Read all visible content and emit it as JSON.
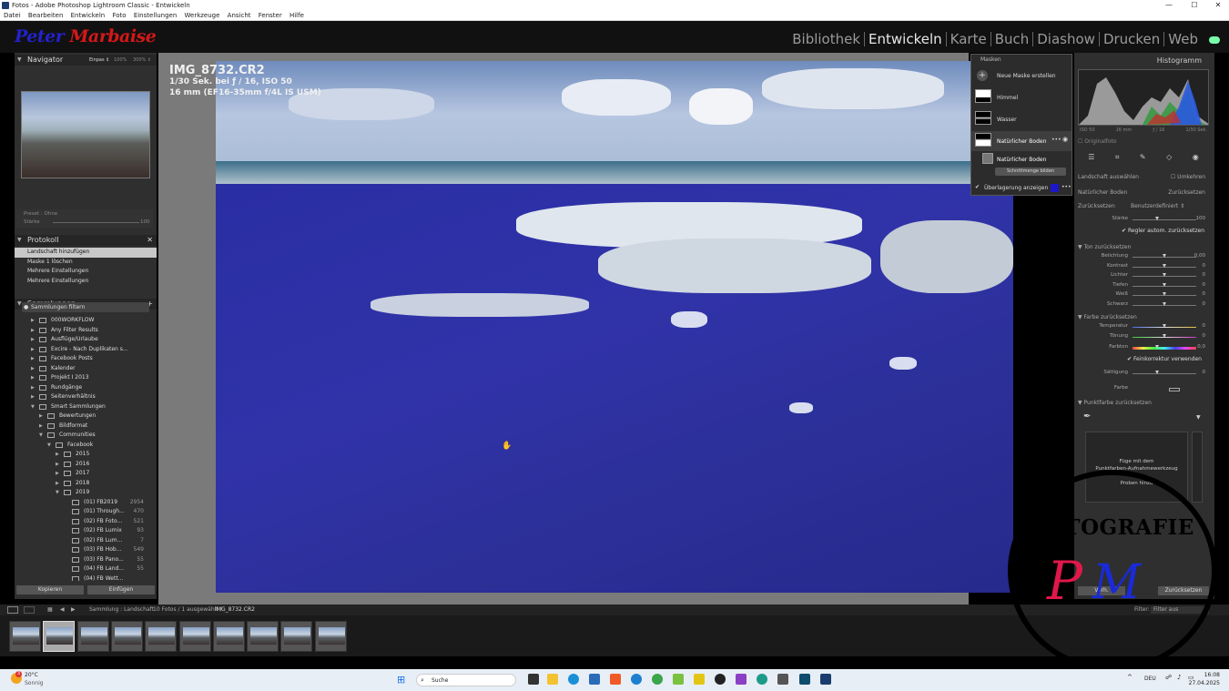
{
  "titlebar": {
    "title": "Fotos - Adobe Photoshop Lightroom Classic - Entwickeln",
    "minimize": "—",
    "maximize": "☐",
    "close": "✕"
  },
  "menu": [
    "Datei",
    "Bearbeiten",
    "Entwickeln",
    "Foto",
    "Einstellungen",
    "Werkzeuge",
    "Ansicht",
    "Fenster",
    "Hilfe"
  ],
  "identity": {
    "logo_first": "Peter",
    "logo_last": "Marbaise"
  },
  "modules": [
    "Bibliothek",
    "Entwickeln",
    "Karte",
    "Buch",
    "Diashow",
    "Drucken",
    "Web"
  ],
  "navigator": {
    "title": "Navigator",
    "zoom_options": [
      "Einpas ⇕",
      "100%",
      "300% ⇕"
    ]
  },
  "preset": {
    "label": "Preset : Ohne",
    "amount_label": "Stärke",
    "amount_value": "100"
  },
  "history": {
    "title": "Protokoll",
    "close": "✕",
    "items": [
      "Landschaft hinzufügen",
      "Maske 1 löschen",
      "Mehrere Einstellungen",
      "Mehrere Einstellungen"
    ]
  },
  "collections": {
    "title": "Sammlungen",
    "filter_placeholder": "Sammlungen filtern",
    "items": [
      {
        "label": "000WORKFLOW",
        "count": ""
      },
      {
        "label": "Any Filter Results",
        "count": ""
      },
      {
        "label": "Ausflüge/Urlaube",
        "count": ""
      },
      {
        "label": "Excire - Nach Duplikaten s...",
        "count": ""
      },
      {
        "label": "Facebook Posts",
        "count": ""
      },
      {
        "label": "Kalender",
        "count": ""
      },
      {
        "label": "Projekt I 2013",
        "count": ""
      },
      {
        "label": "Rundgänge",
        "count": ""
      },
      {
        "label": "Seitenverhältnis",
        "count": ""
      },
      {
        "label": "Smart Sammlungen",
        "count": ""
      },
      {
        "label": "Bewertungen",
        "count": ""
      },
      {
        "label": "Bildformat",
        "count": ""
      },
      {
        "label": "Communities",
        "count": ""
      },
      {
        "label": "Facebook",
        "count": ""
      },
      {
        "label": "2015",
        "count": ""
      },
      {
        "label": "2016",
        "count": ""
      },
      {
        "label": "2017",
        "count": ""
      },
      {
        "label": "2018",
        "count": ""
      },
      {
        "label": "2019",
        "count": ""
      },
      {
        "label": "(01) FB2019",
        "count": "2954"
      },
      {
        "label": "(01) Through...",
        "count": "470"
      },
      {
        "label": "(02) FB Foto...",
        "count": "521"
      },
      {
        "label": "(02) FB Lumix",
        "count": "93"
      },
      {
        "label": "(02) FB Lum...",
        "count": "7"
      },
      {
        "label": "(03) FB Hob...",
        "count": "549"
      },
      {
        "label": "(03) FB Pano...",
        "count": "55"
      },
      {
        "label": "(04) FB Land...",
        "count": "55"
      },
      {
        "label": "(04) FB Wett...",
        "count": ""
      }
    ],
    "copy_button": "Kopieren",
    "paste_button": "Einfügen"
  },
  "photo": {
    "filename": "IMG_8732.CR2",
    "exposure": "1/30 Sek. bei ƒ / 16, ISO 50",
    "lens": "16 mm (EF16-35mm f/4L IS USM)"
  },
  "masks": {
    "title": "Masken",
    "new_mask": "Neue Maske erstellen",
    "items": [
      "Himmel",
      "Wasser",
      "Natürlicher Boden"
    ],
    "sub_item": "Natürlicher Boden",
    "intersect": "Schnittmenge bilden",
    "overlay": "Überlagerung anzeigen",
    "overlay_color": "#1c16c8"
  },
  "histogram": {
    "title": "Histogramm",
    "iso": "ISO 50",
    "focal": "16 mm",
    "aperture": "ƒ / 16",
    "shutter": "1/30 Sek.",
    "original": "Originalfoto"
  },
  "adjust": {
    "landscape_select": "Landschaft auswählen",
    "invert": "Umkehren",
    "mask_name": "Natürlicher Boden",
    "reset": "Zurücksetzen",
    "effect_label": "Zurücksetzen",
    "effect_value": "Benutzerdefiniert ⇕",
    "amount_label": "Stärke",
    "amount_value": "100",
    "auto_reset": "Regler autom. zurücksetzen",
    "tone_head": "Ton zurücksetzen",
    "tone": [
      {
        "label": "Belichtung",
        "value": "0,00",
        "pos": 0.5
      },
      {
        "label": "Kontrast",
        "value": "0",
        "pos": 0.5
      },
      {
        "label": "Lichter",
        "value": "0",
        "pos": 0.5
      },
      {
        "label": "Tiefen",
        "value": "0",
        "pos": 0.5
      },
      {
        "label": "Weiß",
        "value": "0",
        "pos": 0.5
      },
      {
        "label": "Schwarz",
        "value": "0",
        "pos": 0.5
      }
    ],
    "color_head": "Farbe zurücksetzen",
    "color": [
      {
        "label": "Temperatur",
        "value": "0",
        "pos": 0.5
      },
      {
        "label": "Tönung",
        "value": "0",
        "pos": 0.5
      }
    ],
    "hue_label": "Farbton",
    "hue_value": "0,0",
    "fine_adjust": "Feinkorrektur verwenden",
    "saturation_label": "Sättigung",
    "saturation_value": "0",
    "color_label": "Farbe",
    "pointcolor_head": "Punktfarbe zurücksetzen",
    "point_text1": "Füge mit dem",
    "point_text2": "Punktfarben-Aufnahmewerkzeug",
    "point_text3": "Proben hinzu",
    "prev_button": "Vorh.",
    "reset_button": "Zurücksetzen"
  },
  "filmtoolbar": {
    "source": "Sammlung : Landschaft",
    "count": "10 Fotos / 1 ausgewählt /",
    "file": "IMG_8732.CR2",
    "filter_label": "Filter:",
    "filter_value": "Filter aus"
  },
  "filmstrip": {
    "thumbs": 10,
    "selected_index": 1
  },
  "watermark": {
    "text": "FOTOGRAFIE",
    "mono_left": "P",
    "mono_right": "M"
  },
  "taskbar": {
    "temp": "20°C",
    "weather": "Sonnig",
    "search": "Suche",
    "lang": "DEU",
    "time": "16:08",
    "date": "27.04.2025",
    "badge": "3"
  }
}
